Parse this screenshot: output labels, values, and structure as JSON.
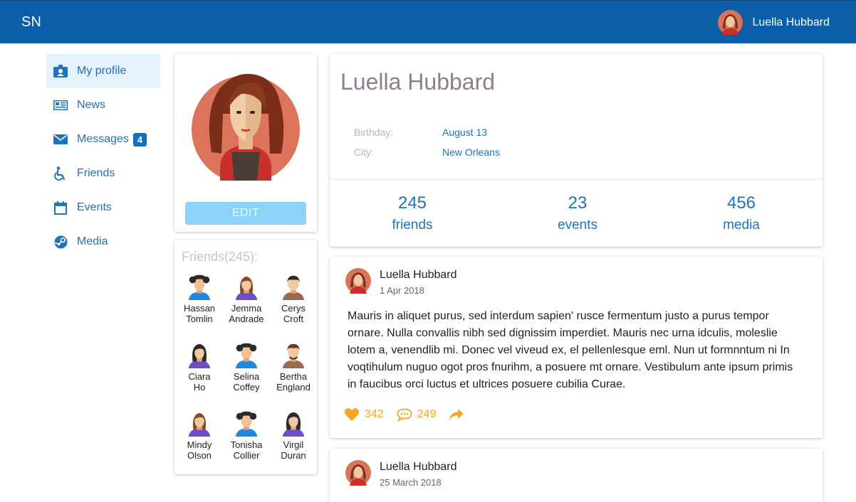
{
  "topbar": {
    "logo": "SN",
    "user_name": "Luella Hubbard"
  },
  "sidebar": {
    "items": [
      {
        "label": "My profile",
        "icon": "id-card-icon",
        "active": true
      },
      {
        "label": "News",
        "icon": "newspaper-icon"
      },
      {
        "label": "Messages",
        "icon": "envelope-icon",
        "badge": "4"
      },
      {
        "label": "Friends",
        "icon": "wheelchair-icon"
      },
      {
        "label": "Events",
        "icon": "calendar-icon"
      },
      {
        "label": "Media",
        "icon": "steam-icon"
      }
    ]
  },
  "avatar_card": {
    "edit_label": "EDIT"
  },
  "friends": {
    "title": "Friends(245):",
    "list": [
      {
        "first": "Hassan",
        "last": "Tomlin"
      },
      {
        "first": "Jemma",
        "last": "Andrade"
      },
      {
        "first": "Cerys",
        "last": "Croft"
      },
      {
        "first": "Ciara",
        "last": "Ho"
      },
      {
        "first": "Selina",
        "last": "Coffey"
      },
      {
        "first": "Bertha",
        "last": "England"
      },
      {
        "first": "Mindy",
        "last": "Olson"
      },
      {
        "first": "Tonisha",
        "last": "Collier"
      },
      {
        "first": "Virgil",
        "last": "Duran"
      }
    ]
  },
  "profile": {
    "name": "Luella Hubbard",
    "birthday_label": "Birthday:",
    "birthday": "August 13",
    "city_label": "City:",
    "city": "New Orleans",
    "stats": [
      {
        "num": "245",
        "label": "friends"
      },
      {
        "num": "23",
        "label": "events"
      },
      {
        "num": "456",
        "label": "media"
      }
    ]
  },
  "posts": [
    {
      "author": "Luella Hubbard",
      "date": "1 Apr 2018",
      "text": "Mauris in aliquet purus, sed interdum sapien' rusce fermentum justo a purus tempor ornare. Nulla convallis nibh sed dignissim imperdiet. Mauris nec urna idculis, moleslie lotem a, venendlib mi. Donec vel viveud ex, el pellenlesque eml. Nun ut formnntum ni In voqtihulum nuguo ogot pros fnurihm, a posuere mt ornare. Vestibulum ante ipsum primis in faucibus orci luctus et ultrices posuere cubilia Curae.",
      "likes": "342",
      "comments": "249"
    },
    {
      "author": "Luella Hubbard",
      "date": "25 March 2018"
    }
  ],
  "colors": {
    "topbar": "#0a5fa8",
    "accent": "#1e73be",
    "action": "#f5a623",
    "edit_button": "#8dd3f7"
  }
}
